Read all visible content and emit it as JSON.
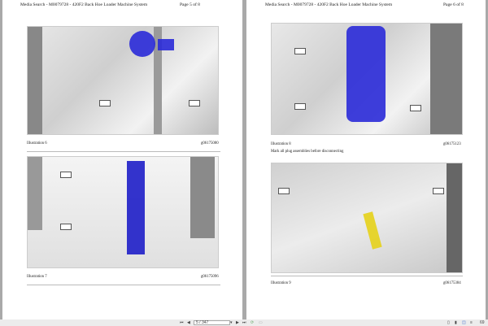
{
  "left_page": {
    "header": "Media Search - M0079728 - 420F2 Back Hoe Loader Machine System",
    "page": "Page 5 of 8",
    "figures": [
      {
        "caption": "Illustration 6",
        "id": "g06175080"
      },
      {
        "caption": "Illustration 7",
        "id": "g06175096"
      }
    ]
  },
  "right_page": {
    "header": "Media Search - M0079728 - 420F2 Back Hoe Loader Machine System",
    "page": "Page 6 of 8",
    "figures": [
      {
        "caption": "Illustration 8",
        "id": "g06175123",
        "note": "Mark all plug assemblies before disconnecting"
      },
      {
        "caption": "Illustration 9",
        "id": "g06175384"
      }
    ]
  },
  "toolbar": {
    "page_value": "5 / 347",
    "zoom": "69"
  }
}
